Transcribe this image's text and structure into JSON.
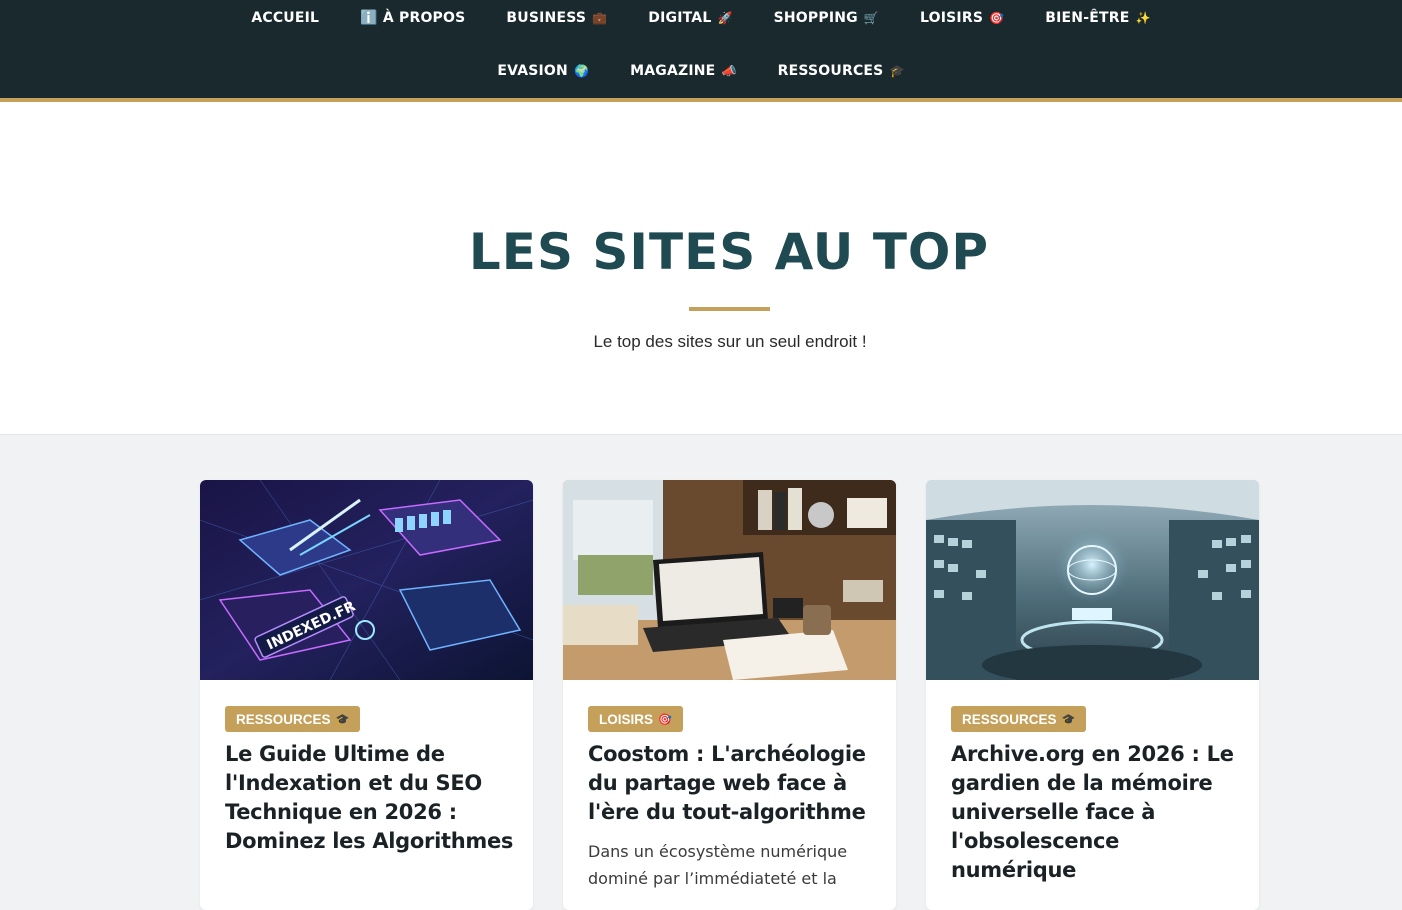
{
  "nav": {
    "row1": [
      {
        "label": "ACCUEIL",
        "emoji": ""
      },
      {
        "label": "ℹ️ À PROPOS",
        "emoji": ""
      },
      {
        "label": "BUSINESS",
        "emoji": "💼"
      },
      {
        "label": "DIGITAL",
        "emoji": "🚀"
      },
      {
        "label": "SHOPPING",
        "emoji": "🛒"
      },
      {
        "label": "LOISIRS",
        "emoji": "🎯"
      },
      {
        "label": "BIEN-ÊTRE",
        "emoji": "✨"
      }
    ],
    "row2": [
      {
        "label": "EVASION",
        "emoji": "🌍"
      },
      {
        "label": "MAGAZINE",
        "emoji": "📣"
      },
      {
        "label": "RESSOURCES",
        "emoji": "🎓"
      }
    ]
  },
  "hero": {
    "title": "LES SITES AU TOP",
    "subtitle": "Le top des sites sur un seul endroit !"
  },
  "cards": [
    {
      "category": "RESSOURCES",
      "category_emoji": "🎓",
      "title": "Le Guide Ultime de l'Indexation et du SEO Technique en 2026 : Dominez les Algorithmes",
      "excerpt": "",
      "image_text": "INDEXED.FR"
    },
    {
      "category": "LOISIRS",
      "category_emoji": "🎯",
      "title": "Coostom : L'archéologie du partage web face à l'ère du tout-algorithme",
      "excerpt": "Dans un écosystème numérique dominé par l’immédiateté et la"
    },
    {
      "category": "RESSOURCES",
      "category_emoji": "🎓",
      "title": "Archive.org en 2026 : Le gardien de la mémoire universelle face à l'obsolescence numérique",
      "excerpt": ""
    }
  ],
  "colors": {
    "nav_bg": "#19292e",
    "accent_gold": "#c4a05a",
    "hero_title": "#1f4a52",
    "page_bg": "#f0f2f4"
  }
}
